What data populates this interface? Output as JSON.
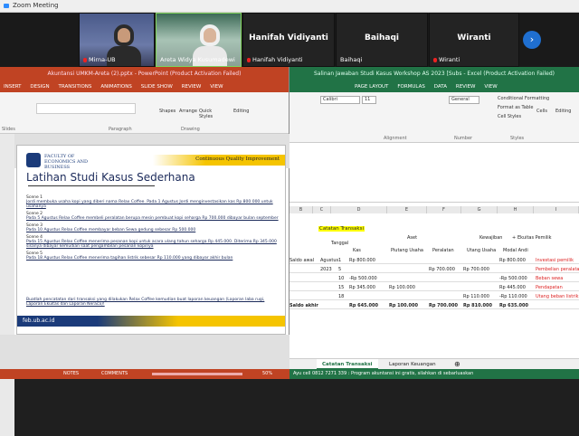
{
  "zoom": {
    "title": "Zoom Meeting"
  },
  "participants": [
    {
      "name": "Mirna-UB",
      "muted": true
    },
    {
      "name": "Areta Widya Kusumadewi",
      "muted": false
    },
    {
      "name": "Hanifah Vidiyanti",
      "muted": true,
      "big": "Hanifah Vidiyanti"
    },
    {
      "name": "Baihaqi",
      "muted": false,
      "big": "Baihaqi"
    },
    {
      "name": "Wiranti",
      "muted": true,
      "big": "Wiranti"
    }
  ],
  "ppt": {
    "title": "Akuntansi UMKM-Areta (2).pptx - PowerPoint (Product Activation Failed)",
    "tabs": [
      "INSERT",
      "DESIGN",
      "TRANSITIONS",
      "ANIMATIONS",
      "SLIDE SHOW",
      "REVIEW",
      "VIEW"
    ],
    "ribbon": {
      "shapes": "Shapes",
      "arrange": "Arrange",
      "quick": "Quick Styles",
      "editing": "Editing",
      "drawing": "Drawing",
      "slides": "Slides",
      "paragraph": "Paragraph"
    },
    "slide": {
      "faculty": "FACULTY OF ECONOMICS AND BUSINESS",
      "cqi": "Continuous Quality Improvement",
      "title": "Latihan Studi Kasus Sederhana",
      "scenes": [
        {
          "h": "Scene 1",
          "t": "Jordi membuka usaha kopi yang diberi nama Relax Coffee. Pada 1 Agustus Jordi menginvestasikan kas Rp 800.000 untuk usahanya"
        },
        {
          "h": "Scene 2",
          "t": "Pada 5 Agustus Relax Coffee membeli peralatan berupa mesin pembuat kopi seharga Rp 700.000 dibayar bulan september"
        },
        {
          "h": "Scene 3",
          "t": "Pada 10 Agustus Relax Coffee membayar beban Sewa gedung sebesar Rp 500.000"
        },
        {
          "h": "Scene 4",
          "t": "Pada 15 Agustus Relax Coffee menerima pesanan kopi untuk acara ulang tahun seharga Rp 445.000. Diterima Rp 345.000 sisanya dibayar kemudian saat pengambilan pesanan kopinya"
        },
        {
          "h": "Scene 5",
          "t": "Pada 18 Agustus Relax Coffee menerima tagihan listrik sebesar Rp 110.000 yang dibayar akhir bulan"
        }
      ],
      "footer_note": "Buatlah pencatatan dari transaksi yang dilakukan Relax Coffee kemudian buat laporan keuangan (Laporan laba rugi, Laporan Ekuitas dan Laporan Neraca)!",
      "url": "feb.ub.ac.id"
    },
    "status": {
      "notes": "NOTES",
      "comments": "COMMENTS",
      "zoom": "50%"
    }
  },
  "xls": {
    "title": "Salinan Jawaban Studi Kasus Workshop AS 2023 [Subs - Excel (Product Activation Failed)",
    "tabs": [
      "FORMULAS",
      "DATA",
      "REVIEW",
      "VIEW"
    ],
    "tabs_left": [
      "PAGE LAYOUT"
    ],
    "ribbon": {
      "font": "Calibri",
      "size": "11",
      "general": "General",
      "cond": "Conditional Formatting",
      "fmt_table": "Format as Table",
      "cell_styles": "Cell Styles",
      "cells": "Cells",
      "editing": "Editing",
      "alignment": "Alignment",
      "number": "Number",
      "styles": "Styles"
    },
    "columns": [
      "B",
      "C",
      "D",
      "E",
      "F",
      "G",
      "H",
      "I"
    ],
    "section_title": "Catatan Transaksi",
    "headers": {
      "tanggal": "Tanggal",
      "aset": "Aset",
      "kewajiban": "Kewajiban",
      "plus": "+",
      "ekuitas": "Ekuitas Pemilik",
      "kas": "Kas",
      "piutang": "Piutang Usaha",
      "peralatan": "Peralatan",
      "utang": "Utang Usaha",
      "modal": "Modal Andi"
    },
    "rows": [
      {
        "label": "Saldo awal",
        "tgl": "Agustus",
        "tglb": "1",
        "kas": "Rp    800.000",
        "piut": "",
        "per": "",
        "utang": "",
        "modal": "Rp    800.000",
        "note": "Investasi pemilik"
      },
      {
        "label": "",
        "tgl": "2023",
        "tglb": "5",
        "kas": "",
        "piut": "",
        "per": "Rp    700.000",
        "utang": "Rp    700.000",
        "modal": "",
        "note": "Pembelian peralatan"
      },
      {
        "label": "",
        "tgl": "",
        "tglb": "10",
        "kas": "-Rp    500.000",
        "piut": "",
        "per": "",
        "utang": "",
        "modal": "-Rp    500.000",
        "note": "Beban sewa"
      },
      {
        "label": "",
        "tgl": "",
        "tglb": "15",
        "kas": "Rp    345.000",
        "piut": "Rp    100.000",
        "per": "",
        "utang": "",
        "modal": "Rp    445.000",
        "note": "Pendapatan"
      },
      {
        "label": "",
        "tgl": "",
        "tglb": "18",
        "kas": "",
        "piut": "",
        "per": "",
        "utang": "Rp    110.000",
        "modal": "-Rp    110.000",
        "note": "Utang beban listrik"
      },
      {
        "label": "Saldo akhir",
        "tgl": "",
        "tglb": "",
        "kas": "Rp    645.000",
        "piut": "Rp    100.000",
        "per": "Rp    700.000",
        "utang": "Rp    810.000",
        "modal": "Rp    635.000",
        "note": ""
      }
    ],
    "sheets": [
      "Catatan Transaksi",
      "Laporan Keuangan"
    ],
    "status": "Ayu cell 0812 7271 339 : Program akuntansi ini gratis, silahkan di sebarluaskan"
  },
  "colors": {
    "ppt": "#c04323",
    "xls": "#217346",
    "zoom_blue": "#2d8cff"
  }
}
